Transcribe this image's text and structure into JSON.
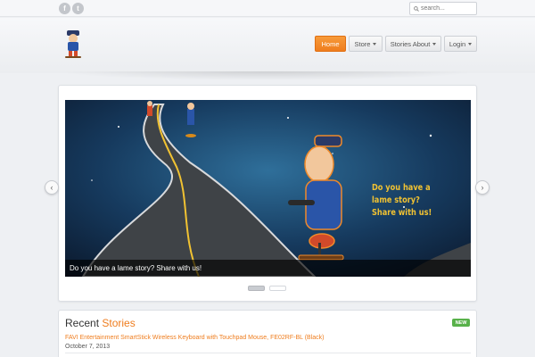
{
  "topbar": {
    "social": [
      {
        "icon": "facebook-icon",
        "glyph": "f"
      },
      {
        "icon": "twitter-icon",
        "glyph": "t"
      }
    ],
    "search": {
      "placeholder": "search..."
    }
  },
  "nav": {
    "home": "Home",
    "store": "Store",
    "stories_about": "Stories About",
    "login": "Login"
  },
  "slider": {
    "caption": "Do you have a lame story? Share with us!",
    "slide_text_line1": "Do you have a lame story?",
    "slide_text_line2": "Share with us!",
    "prev_glyph": "‹",
    "next_glyph": "›",
    "slide_count": 2,
    "active_slide": 1
  },
  "recent": {
    "title_plain": "Recent",
    "title_accent": "Stories",
    "badge": "NEW",
    "items": [
      {
        "title": "FAVI Entertainment SmartStick Wireless Keyboard with Touchpad Mouse, FE02RF-BL (Black)",
        "date": "October 7, 2013"
      }
    ]
  },
  "colors": {
    "accent": "#ef7d1e",
    "badge": "#58b14a",
    "slide_text": "#f1c232"
  }
}
